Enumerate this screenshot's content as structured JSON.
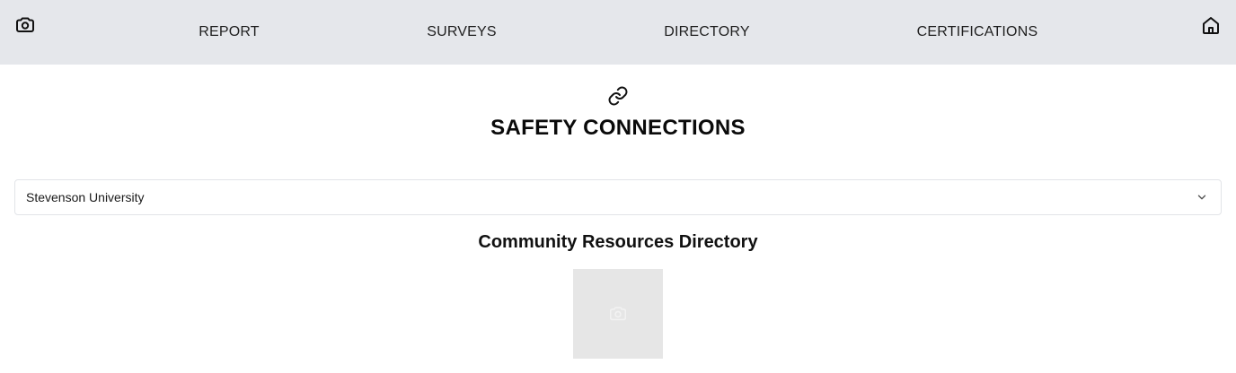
{
  "header": {
    "nav": [
      {
        "label": "REPORT"
      },
      {
        "label": "SURVEYS"
      },
      {
        "label": "DIRECTORY"
      },
      {
        "label": "CERTIFICATIONS"
      }
    ],
    "left_icon": "camera-icon",
    "right_icon": "home-icon"
  },
  "main": {
    "top_icon": "link-icon",
    "title": "SAFETY CONNECTIONS",
    "institution_select": {
      "value": "Stevenson University",
      "icon": "chevron-down-icon"
    },
    "section_title": "Community Resources Directory",
    "image_placeholder_icon": "image-placeholder-icon"
  },
  "colors": {
    "topbar_bg": "#e5e7eb",
    "placeholder_bg": "#e6e6e6",
    "select_border": "#e2e4e8"
  }
}
